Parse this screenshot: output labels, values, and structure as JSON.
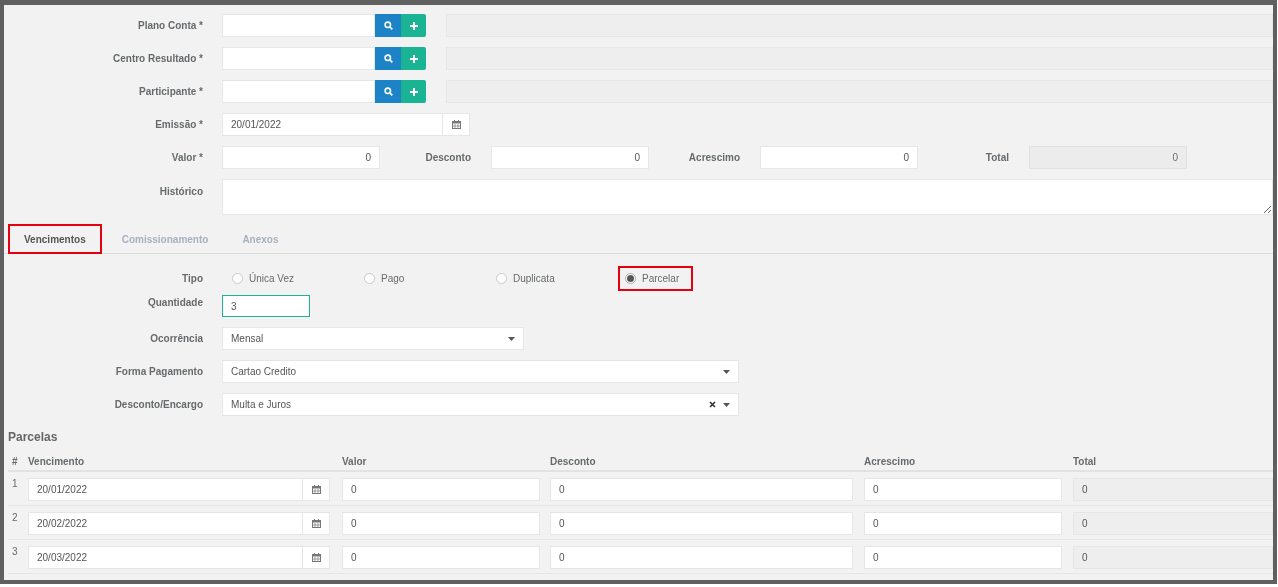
{
  "lookups": [
    {
      "label": "Plano Conta *"
    },
    {
      "label": "Centro Resultado *"
    },
    {
      "label": "Participante *"
    }
  ],
  "emissao": {
    "label": "Emissão *",
    "value": "20/01/2022"
  },
  "amounts": [
    {
      "label": "Valor *",
      "value": "0",
      "readonly": false
    },
    {
      "label": "Desconto",
      "value": "0",
      "readonly": false
    },
    {
      "label": "Acrescimo",
      "value": "0",
      "readonly": false
    },
    {
      "label": "Total",
      "value": "0",
      "readonly": true
    }
  ],
  "historico": {
    "label": "Histórico"
  },
  "tabs": [
    {
      "label": "Vencimentos",
      "selected": true,
      "highlighted": true
    },
    {
      "label": "Comissionamento",
      "selected": false,
      "highlighted": false
    },
    {
      "label": "Anexos",
      "selected": false,
      "highlighted": false
    }
  ],
  "tipo": {
    "label": "Tipo",
    "options": [
      {
        "label": "Única Vez",
        "selected": false,
        "highlighted": false
      },
      {
        "label": "Pago",
        "selected": false,
        "highlighted": false
      },
      {
        "label": "Duplicata",
        "selected": false,
        "highlighted": false
      },
      {
        "label": "Parcelar",
        "selected": true,
        "highlighted": true
      }
    ]
  },
  "quantidade": {
    "label": "Quantidade",
    "value": "3",
    "focused": true
  },
  "selects": [
    {
      "label": "Ocorrência",
      "value": "Mensal",
      "clearable": false
    },
    {
      "label": "Forma Pagamento",
      "value": "Cartao Credito",
      "clearable": false
    },
    {
      "label": "Desconto/Encargo",
      "value": "Multa e Juros",
      "clearable": true
    }
  ],
  "parcelas": {
    "title": "Parcelas",
    "columns": [
      "#",
      "Vencimento",
      "Valor",
      "Desconto",
      "Acrescimo",
      "Total"
    ],
    "rows": [
      {
        "number": "1",
        "vencimento": "20/01/2022",
        "valor": "0",
        "desconto": "0",
        "acrescimo": "0",
        "total": "0"
      },
      {
        "number": "2",
        "vencimento": "20/02/2022",
        "valor": "0",
        "desconto": "0",
        "acrescimo": "0",
        "total": "0"
      },
      {
        "number": "3",
        "vencimento": "20/03/2022",
        "valor": "0",
        "desconto": "0",
        "acrescimo": "0",
        "total": "0"
      }
    ]
  }
}
